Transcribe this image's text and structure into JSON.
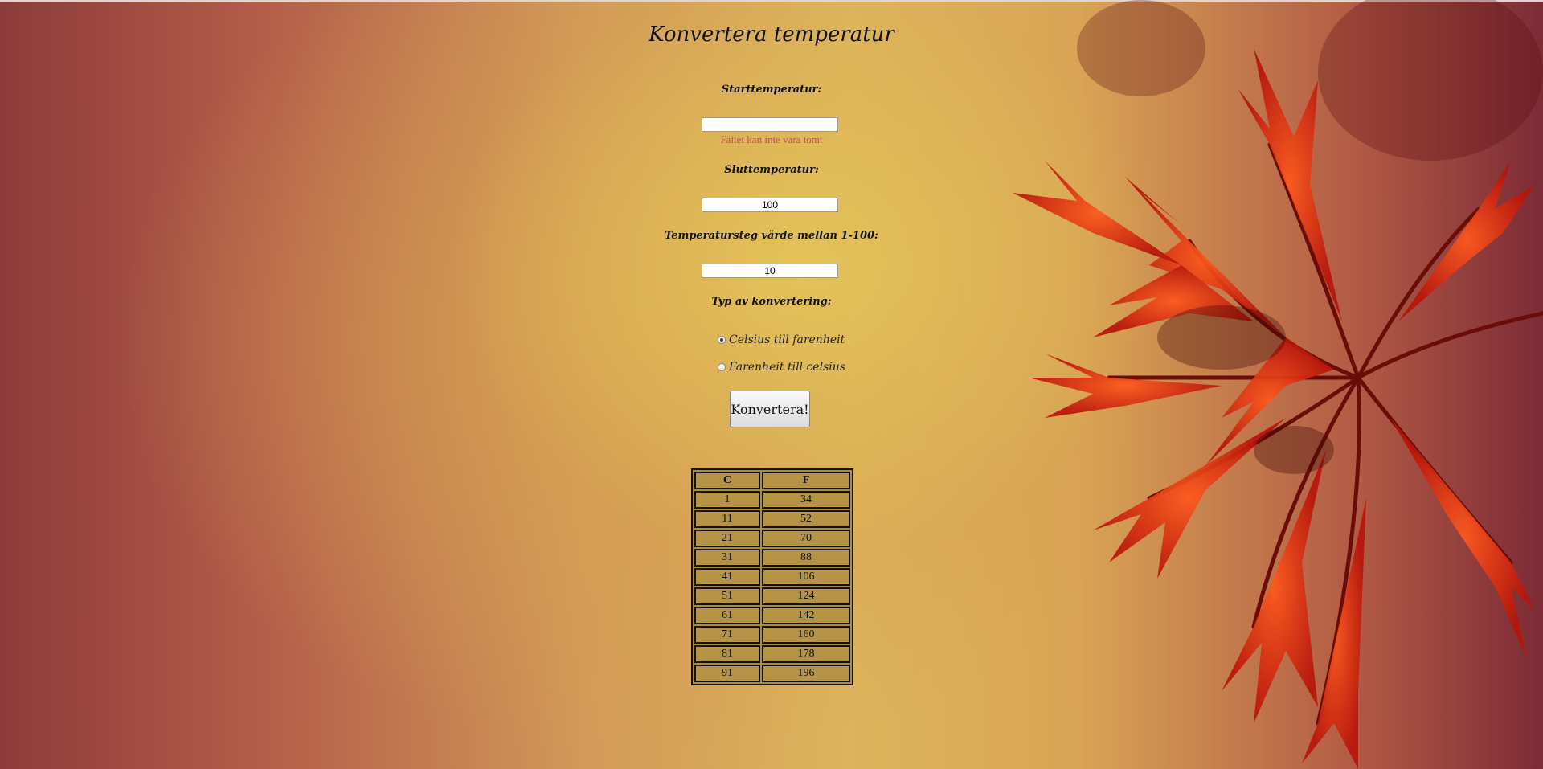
{
  "page": {
    "title": "Konvertera temperatur"
  },
  "form": {
    "start": {
      "label": "Starttemperatur:",
      "value": "",
      "error": "Fältet kan inte vara tomt"
    },
    "end": {
      "label": "Sluttemperatur:",
      "value": "100"
    },
    "step": {
      "label": "Temperatursteg värde mellan 1-100:",
      "value": "10"
    },
    "conversion": {
      "label": "Typ av konvertering:",
      "options": [
        {
          "label": "Celsius till farenheit",
          "checked": true
        },
        {
          "label": "Farenheit till celsius",
          "checked": false
        }
      ]
    },
    "submit_label": "Konvertera!"
  },
  "table": {
    "headers": [
      "C",
      "F"
    ],
    "rows": [
      [
        "1",
        "34"
      ],
      [
        "11",
        "52"
      ],
      [
        "21",
        "70"
      ],
      [
        "31",
        "88"
      ],
      [
        "41",
        "106"
      ],
      [
        "51",
        "124"
      ],
      [
        "61",
        "142"
      ],
      [
        "71",
        "160"
      ],
      [
        "81",
        "178"
      ],
      [
        "91",
        "196"
      ]
    ]
  },
  "colors": {
    "error": "#c0504d",
    "table_cell": "#b59447",
    "leaf": "#d42a12"
  }
}
